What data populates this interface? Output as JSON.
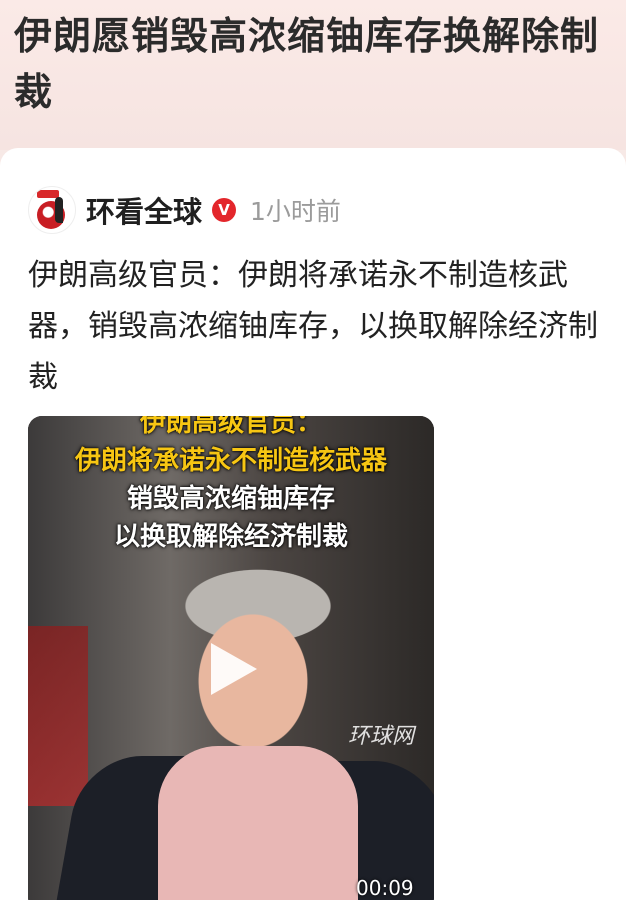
{
  "header": {
    "headline": "伊朗愿销毁高浓缩铀库存换解除制裁"
  },
  "post": {
    "author": "环看全球",
    "verified_mark": "V",
    "time": "1小时前",
    "text": "伊朗高级官员：伊朗将承诺永不制造核武器，销毁高浓缩铀库存，以换取解除经济制裁"
  },
  "video": {
    "caption_line0": "伊朗高级官员：",
    "caption_line1": "伊朗将承诺永不制造核武器",
    "caption_line2": "销毁高浓缩铀库存",
    "caption_line3": "以换取解除经济制裁",
    "watermark": "环球网",
    "duration": "00:09",
    "play_icon": "play-icon"
  },
  "colors": {
    "header_bg": "#f7e9e6",
    "verified_red": "#e3262b",
    "caption_yellow": "#f7c613",
    "time_gray": "#9b9b9b"
  }
}
